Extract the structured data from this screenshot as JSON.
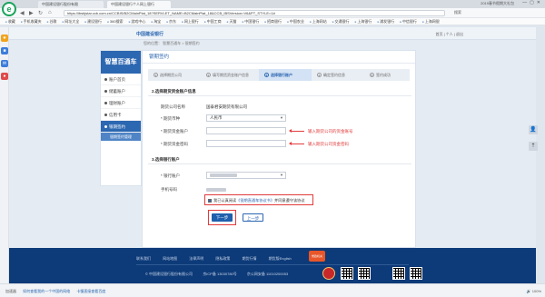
{
  "browser": {
    "tabs": [
      "中国建设银行股份有限",
      "中国建设银行个人网上银行"
    ],
    "tab_right_info": "2019春节假期大礼包",
    "url": "https://ibsbjstar.ccb.com.cn/CCBIS/B2CMainPlat_18?SERVLET_NAME=B2CMainPlat_18&CCB_IBSVersion=V6&PT_STYLE=1#",
    "addr_right": "搜索",
    "bookmarks": [
      "收藏",
      "手机收藏夹",
      "谷歌",
      "网址大全",
      "建设银行",
      "360搜索",
      "游戏中心",
      "淘宝",
      "京东",
      "网上银行",
      "中国工商",
      "天猫",
      "中国银行",
      "招商银行",
      "中国农业",
      "上海网站",
      "交通银行",
      "上海银行",
      "浦发银行",
      "中信银行",
      "上海网银"
    ]
  },
  "header": {
    "logo": "中国建设银行",
    "right_links": "首页 | 个人 | 退出"
  },
  "sidebar": {
    "title": "智慧百通车",
    "items": [
      {
        "label": "账户首页"
      },
      {
        "label": "储蓄账户"
      },
      {
        "label": "理财账户"
      },
      {
        "label": "信用卡"
      },
      {
        "label": "银期签约"
      }
    ],
    "sub": "银期签约管理"
  },
  "breadcrumb": "您的位置：   智慧百通车 > 银期签约",
  "main": {
    "title": "银期签约",
    "steps": [
      {
        "num": "1",
        "label": "选择期货公司"
      },
      {
        "num": "2",
        "label": "填写期货资金账户信息"
      },
      {
        "num": "3",
        "label": "选择银行账户"
      },
      {
        "num": "4",
        "label": "确定签约信息"
      },
      {
        "num": "5",
        "label": "签约成功"
      }
    ],
    "section1_title": "2.选择期货资金账户信息",
    "futures_company_label": "期货公司名称",
    "futures_company_value": "国泰君安期货有限公司",
    "currency_label": "* 期货币种",
    "currency_value": "人民币",
    "fund_account_label": "* 期货资金账户",
    "fund_password_label": "* 期货资金密码",
    "annot_account": "输入期货公司的资金账号",
    "annot_password": "输入期货公司资金密码",
    "section2_title": "3.选择银行账户",
    "bank_account_label": "* 银行账户",
    "phone_label": "手机号码",
    "agree_prefix": "我已认真阅读",
    "agree_link": "《银期直通车协议书》",
    "agree_suffix": "并同意遵守该协议",
    "btn_next": "下一步",
    "btn_prev": "上一步"
  },
  "footer": {
    "links": [
      "联系我们",
      "网站地图",
      "法律声明",
      "隐私政策",
      "期货行情"
    ],
    "english": "期货版English",
    "info": [
      "© 中国建设银行股份有限公司",
      "京ICP备 13030780号",
      "京公网安备 11010200053"
    ],
    "badge": "党政机关"
  },
  "status": {
    "left": "加速器",
    "link1": "如何查看我的一个中国的网络",
    "link2": "卡慢直接查看百度",
    "right": "🔊 100%"
  },
  "colors": {
    "brand": "#2c67b1",
    "footer": "#0d3a78",
    "annotation": "#e23b3b"
  }
}
